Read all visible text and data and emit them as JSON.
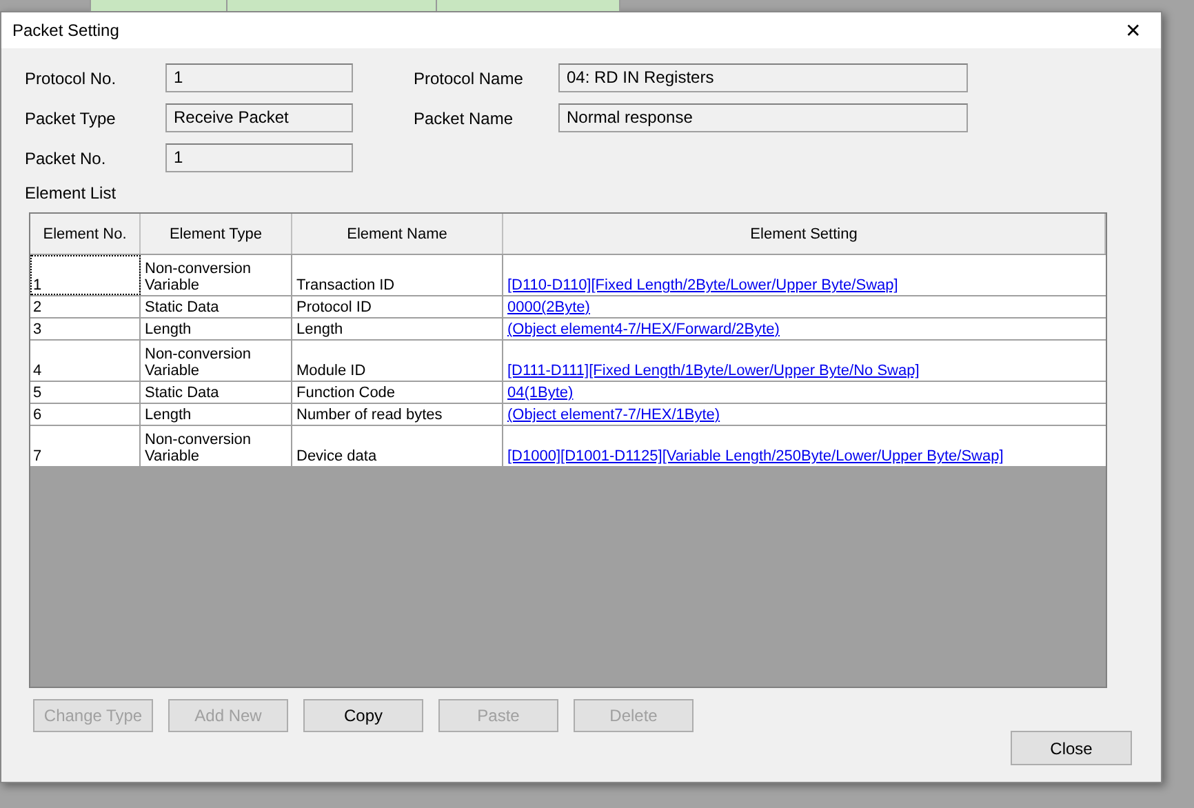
{
  "window": {
    "title": "Packet Setting",
    "close_glyph": "✕"
  },
  "fields": [
    {
      "label": "Protocol No.",
      "value": "1"
    },
    {
      "label": "Protocol Name",
      "value": "04: RD IN Registers"
    },
    {
      "label": "Packet Type",
      "value": "Receive Packet"
    },
    {
      "label": "Packet Name",
      "value": "Normal response"
    },
    {
      "label": "Packet No.",
      "value": "1"
    }
  ],
  "element_list": {
    "title": "Element List",
    "columns": [
      "Element No.",
      "Element Type",
      "Element Name",
      "Element Setting"
    ],
    "rows": [
      {
        "no": "1",
        "type": [
          "Non-conversion",
          "Variable"
        ],
        "name": "Transaction ID",
        "setting": "[D110-D110][Fixed Length/2Byte/Lower/Upper Byte/Swap]",
        "selected": true
      },
      {
        "no": "2",
        "type": [
          "Static Data"
        ],
        "name": "Protocol ID",
        "setting": "0000(2Byte)",
        "selected": false
      },
      {
        "no": "3",
        "type": [
          "Length"
        ],
        "name": "Length",
        "setting": "(Object element4-7/HEX/Forward/2Byte)",
        "selected": false
      },
      {
        "no": "4",
        "type": [
          "Non-conversion",
          "Variable"
        ],
        "name": "Module ID",
        "setting": "[D111-D111][Fixed Length/1Byte/Lower/Upper Byte/No Swap]",
        "selected": false
      },
      {
        "no": "5",
        "type": [
          "Static Data"
        ],
        "name": "Function Code",
        "setting": "04(1Byte)",
        "selected": false
      },
      {
        "no": "6",
        "type": [
          "Length"
        ],
        "name": "Number of read bytes",
        "setting": "(Object element7-7/HEX/1Byte)",
        "selected": false
      },
      {
        "no": "7",
        "type": [
          "Non-conversion",
          "Variable"
        ],
        "name": "Device data",
        "setting": "[D1000][D1001-D1125][Variable Length/250Byte/Lower/Upper Byte/Swap]",
        "selected": false
      }
    ]
  },
  "buttons": [
    {
      "label": "Change Type",
      "disabled": true
    },
    {
      "label": "Add New",
      "disabled": true
    },
    {
      "label": "Copy",
      "disabled": false
    },
    {
      "label": "Paste",
      "disabled": true
    },
    {
      "label": "Delete",
      "disabled": true
    }
  ],
  "close_button": {
    "label": "Close"
  }
}
